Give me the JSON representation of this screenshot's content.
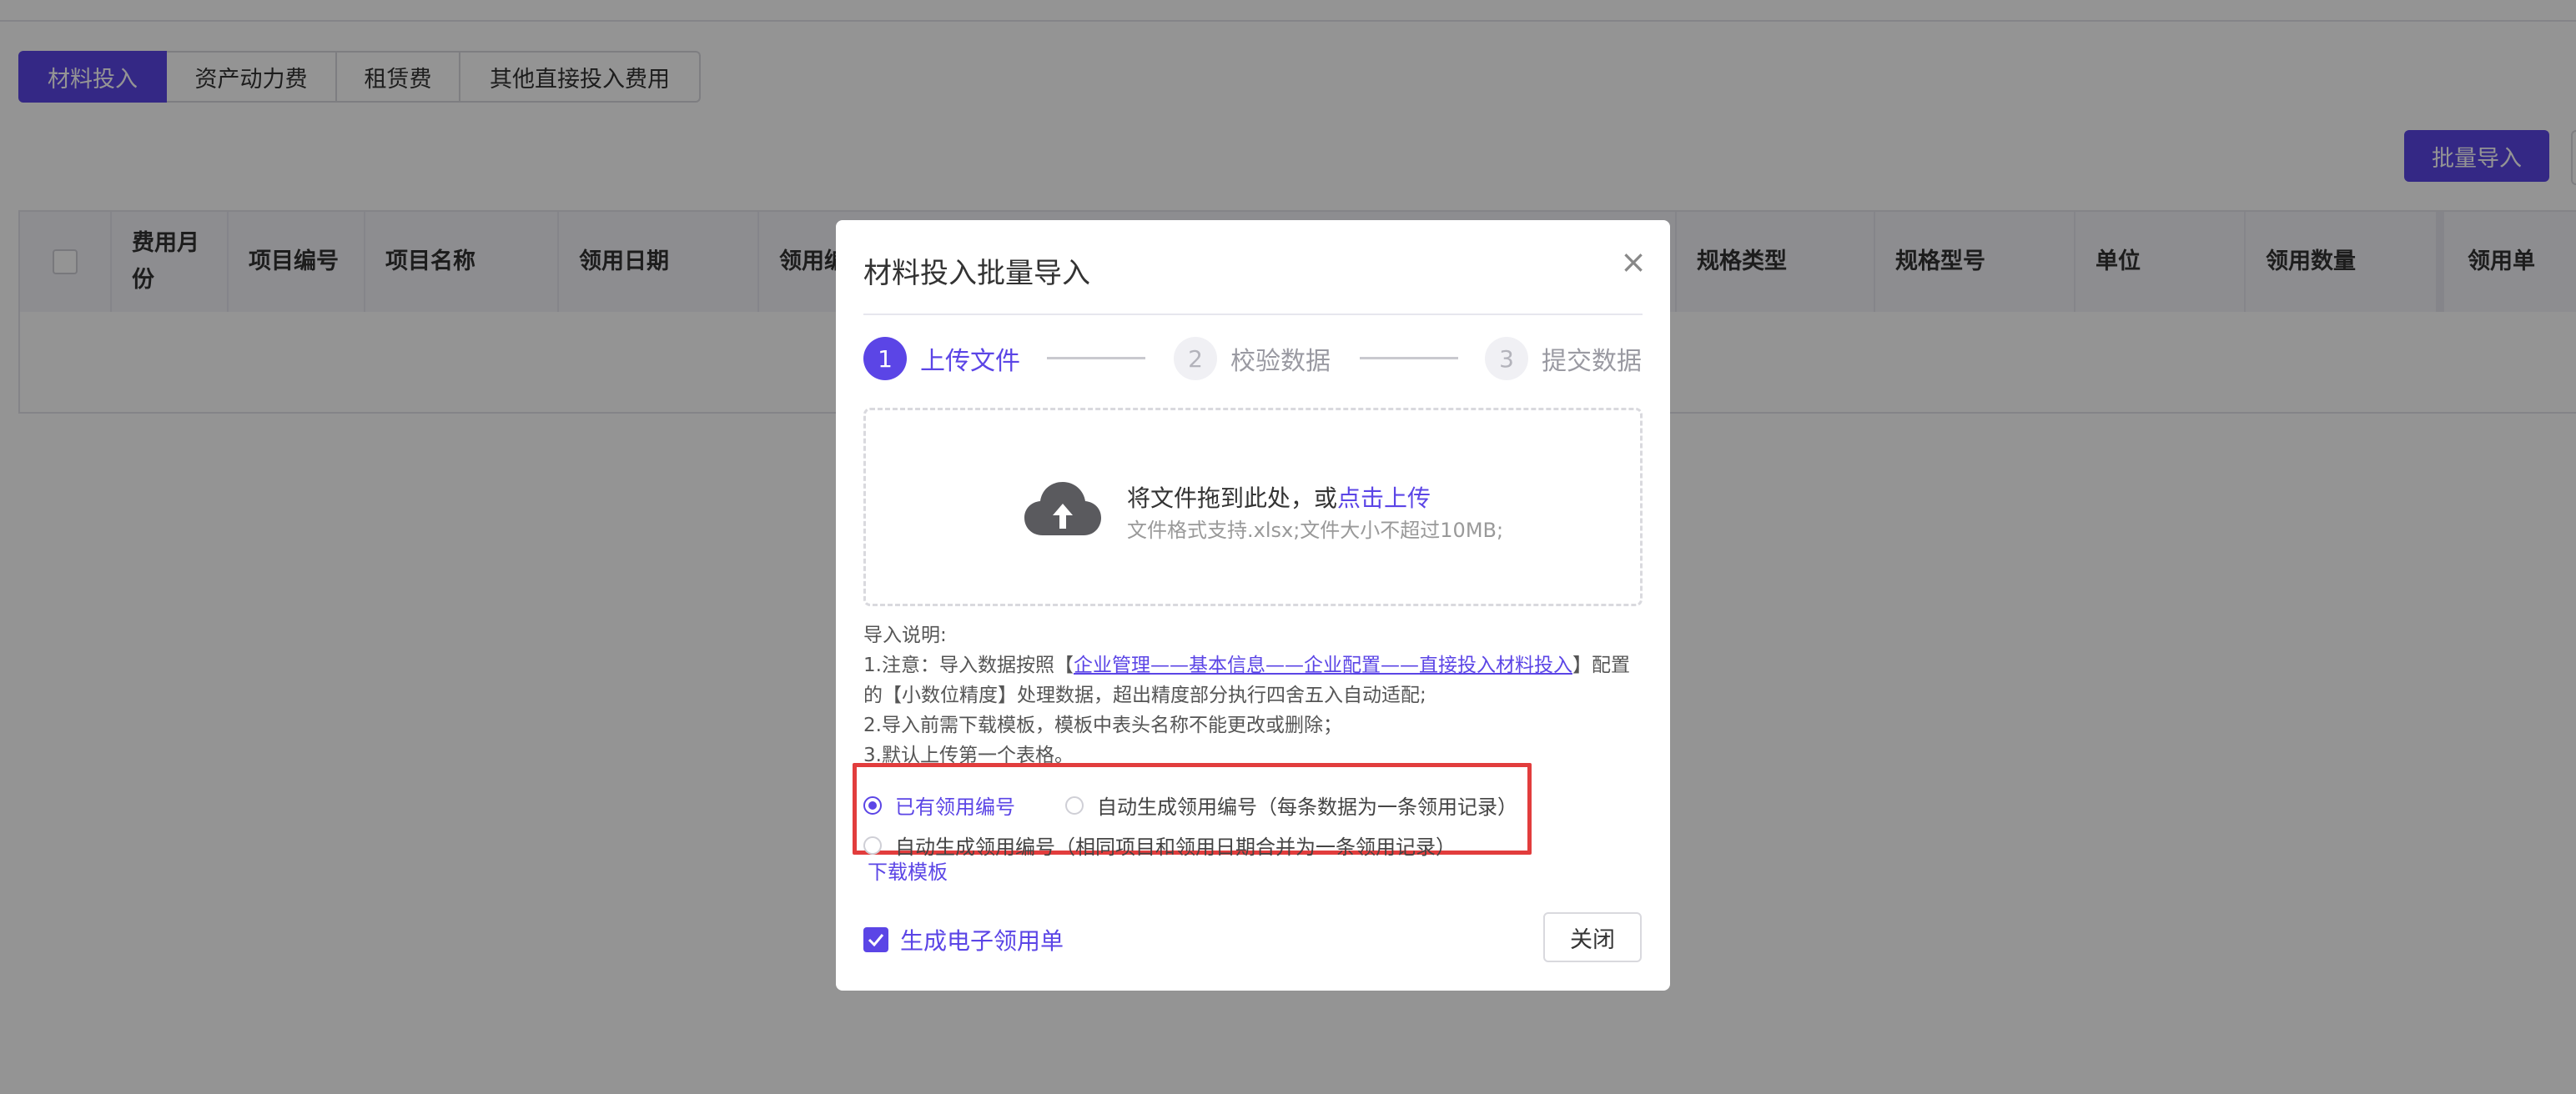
{
  "tabs": [
    "材料投入",
    "资产动力费",
    "租赁费",
    "其他直接投入费用"
  ],
  "toolbar": {
    "batch_import": "批量导入"
  },
  "table": {
    "headers": {
      "month": "费用月份",
      "project_no": "项目编号",
      "project_name": "项目名称",
      "date": "领用日期",
      "no": "领用编",
      "spec_type": "规格类型",
      "spec_model": "规格型号",
      "unit": "单位",
      "qty": "领用数量",
      "price": "领用单"
    }
  },
  "dialog": {
    "title": "材料投入批量导入",
    "steps": [
      {
        "num": "1",
        "label": "上传文件"
      },
      {
        "num": "2",
        "label": "校验数据"
      },
      {
        "num": "3",
        "label": "提交数据"
      }
    ],
    "upload": {
      "text": "将文件拖到此处，或",
      "link": "点击上传",
      "hint": "文件格式支持.xlsx;文件大小不超过10MB;"
    },
    "notes": {
      "heading": "导入说明:",
      "line1_a": "1.注意：导入数据按照【",
      "line1_link": "企业管理——基本信息——企业配置——直接投入材料投入",
      "line1_b": "】配置的【小数位精度】处理数据，超出精度部分执行四舍五入自动适配;",
      "line2": "2.导入前需下载模板，模板中表头名称不能更改或删除；",
      "line3": "3.默认上传第一个表格。"
    },
    "options": {
      "existing": "已有领用编号",
      "auto_each": "自动生成领用编号（每条数据为一条领用记录）",
      "auto_merge": "自动生成领用编号（相同项目和领用日期合并为一条领用记录）"
    },
    "download_template": "下载模板",
    "generate_receipt": "生成电子领用单",
    "close": "关闭"
  },
  "colors": {
    "accent": "#5b45e6",
    "highlight": "#e23d3d"
  }
}
